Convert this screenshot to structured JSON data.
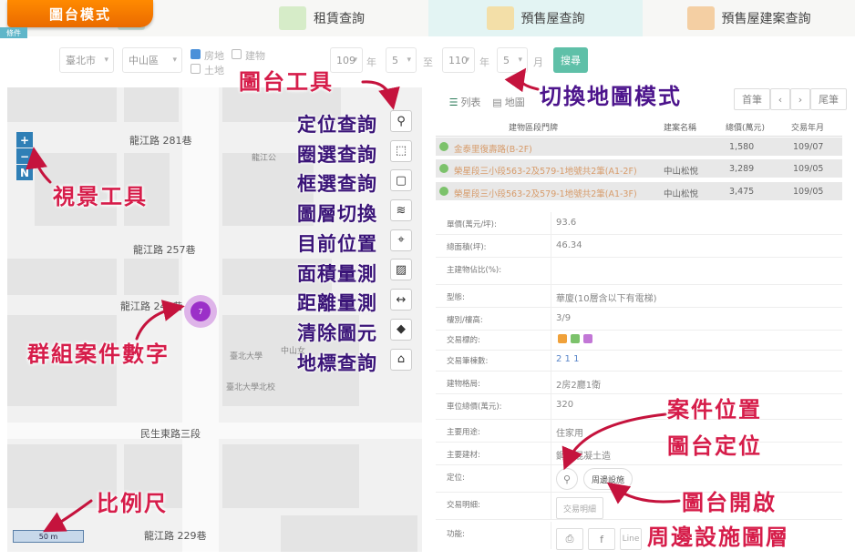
{
  "header": {
    "mode_title": "圖台模式",
    "corner_tag": "條件",
    "tabs": [
      {
        "label": "",
        "icon": "building-icon"
      },
      {
        "label": "租賃查詢",
        "icon": "building-icon"
      },
      {
        "label": "預售屋查詢",
        "icon": "crane-icon"
      },
      {
        "label": "預售屋建案查詢",
        "icon": "building-icon"
      }
    ]
  },
  "filters": {
    "city": "臺北市",
    "district": "中山區",
    "type1": "房地",
    "type2": "建物",
    "type3": "土地",
    "year_from": "109",
    "year_unit1": "年",
    "month_from": "5",
    "to_label": "至",
    "year_to": "110",
    "year_unit2": "年",
    "month_to": "5",
    "month_unit": "月",
    "search_label": "搜尋"
  },
  "map": {
    "roads": [
      "龍江路 281巷",
      "龍江路 257巷",
      "龍江路 245巷",
      "民生東路三段",
      "龍江路 229巷"
    ],
    "pois": [
      "龍江公",
      "臺北大學",
      "臺北大學北校",
      "中山女"
    ],
    "cluster_count": "7",
    "scale_label": "50 m",
    "zoom_in": "+",
    "zoom_out": "−",
    "north": "N"
  },
  "tools": [
    {
      "label": "定位查詢",
      "icon": "locate-pin-icon"
    },
    {
      "label": "圈選查詢",
      "icon": "circle-select-icon"
    },
    {
      "label": "框選查詢",
      "icon": "box-select-icon"
    },
    {
      "label": "圖層切換",
      "icon": "layers-icon"
    },
    {
      "label": "目前位置",
      "icon": "crosshair-icon"
    },
    {
      "label": "面積量測",
      "icon": "area-measure-icon"
    },
    {
      "label": "距離量測",
      "icon": "distance-measure-icon"
    },
    {
      "label": "清除圖元",
      "icon": "eraser-icon"
    },
    {
      "label": "地標查詢",
      "icon": "landmark-icon"
    }
  ],
  "annotations": {
    "map_tools": "圖台工具",
    "view_tools": "視景工具",
    "cluster": "群組案件數字",
    "scale": "比例尺",
    "switch_mode": "切換地圖模式",
    "case_location": "案件位置",
    "map_locate": "圖台定位",
    "map_open": "圖台開啟",
    "nearby_layer": "周邊設施圖層"
  },
  "panel": {
    "view_list": "列表",
    "view_map": "地圖",
    "pager": {
      "first": "首筆",
      "prev": "‹",
      "next": "›",
      "last": "尾筆"
    },
    "columns": [
      "建物區段門牌",
      "建案名稱",
      "總價(萬元)",
      "交易年月"
    ],
    "rows": [
      {
        "address": "金泰里復壽路(B-2F)",
        "project": "",
        "price": "1,580",
        "date": "109/07"
      },
      {
        "address": "榮星段三小段563-2及579-1地號共2筆(A1-2F)",
        "project": "中山松悅",
        "price": "3,289",
        "date": "109/05"
      },
      {
        "address": "榮星段三小段563-2及579-1地號共2筆(A1-3F)",
        "project": "中山松悅",
        "price": "3,475",
        "date": "109/05"
      }
    ],
    "details": [
      {
        "k": "單價(萬元/坪):",
        "v": "93.6"
      },
      {
        "k": "總面積(坪):",
        "v": "46.34"
      },
      {
        "k": "主建物佔比(%):",
        "v": ""
      },
      {
        "k": "型態:",
        "v": "華廈(10層含以下有電梯)"
      },
      {
        "k": "樓別/樓高:",
        "v": "3/9"
      },
      {
        "k": "交易標的:",
        "v": ""
      },
      {
        "k": "交易筆棟數:",
        "v": "2  1  1"
      },
      {
        "k": "建物格局:",
        "v": "2房2廳1衛"
      },
      {
        "k": "車位總價(萬元):",
        "v": "320"
      },
      {
        "k": "主要用途:",
        "v": "住家用"
      },
      {
        "k": "主要建材:",
        "v": "鋼筋混凝土造"
      },
      {
        "k": "定位:",
        "v": ""
      },
      {
        "k": "交易明細:",
        "v": ""
      },
      {
        "k": "功能:",
        "v": ""
      }
    ],
    "nearby_btn": "周邊設施",
    "detail_btn": "交易明細",
    "line_btn": "Line"
  }
}
